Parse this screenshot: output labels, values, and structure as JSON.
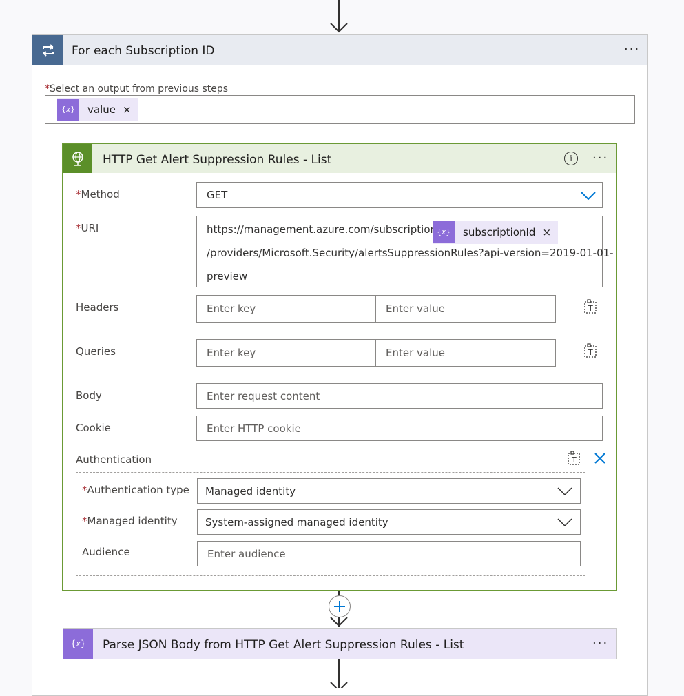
{
  "foreach": {
    "title": "For each Subscription ID",
    "more": "···",
    "select_label": "Select an output from previous steps",
    "required_mark": "*",
    "token_icon": "{𝑥}",
    "token_label": "value",
    "token_remove": "×"
  },
  "http": {
    "title": "HTTP Get Alert Suppression Rules - List",
    "info": "i",
    "more": "···",
    "method_label": "Method",
    "method_value": "GET",
    "uri_label": "URI",
    "uri_part1": "https://management.azure.com/subscriptions/",
    "uri_token": "subscriptionId",
    "uri_token_remove": "×",
    "uri_part2": "/providers/Microsoft.Security/alertsSuppressionRules?api-version=2019-01-01-",
    "uri_part3": "preview",
    "headers_label": "Headers",
    "headers_key_placeholder": "Enter key",
    "headers_value_placeholder": "Enter value",
    "queries_label": "Queries",
    "queries_key_placeholder": "Enter key",
    "queries_value_placeholder": "Enter value",
    "body_label": "Body",
    "body_placeholder": "Enter request content",
    "cookie_label": "Cookie",
    "cookie_placeholder": "Enter HTTP cookie",
    "auth_label": "Authentication",
    "auth_type_label": "Authentication type",
    "auth_type_value": "Managed identity",
    "managed_identity_label": "Managed identity",
    "managed_identity_value": "System-assigned managed identity",
    "audience_label": "Audience",
    "audience_placeholder": "Enter audience"
  },
  "parse": {
    "title": "Parse JSON Body from HTTP Get Alert Suppression Rules - List",
    "more": "···"
  },
  "colors": {
    "foreach_accent": "#486991",
    "http_accent": "#5b8f29",
    "token_accent": "#8c6cd9",
    "link_blue": "#0078d4",
    "required": "#a4262c"
  }
}
